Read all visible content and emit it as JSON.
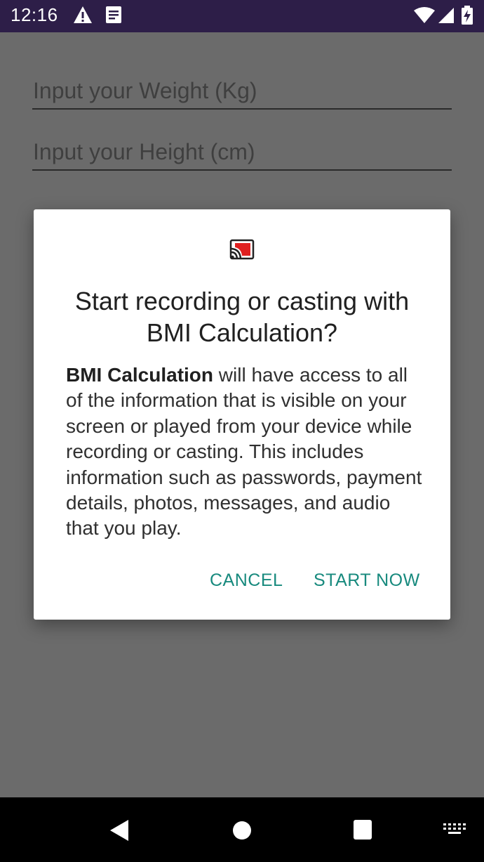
{
  "status_bar": {
    "time": "12:16",
    "left_icons": [
      "warning-icon",
      "notes-icon"
    ],
    "right_icons": [
      "wifi-icon",
      "signal-icon",
      "battery-charging-icon"
    ]
  },
  "form": {
    "weight_placeholder": "Input your Weight (Kg)",
    "height_placeholder": "Input your Height (cm)"
  },
  "dialog": {
    "icon": "cast-icon",
    "title": "Start recording or casting with BMI Calculation?",
    "message_app_name": "BMI Calculation",
    "message_rest": " will have access to all of the information that is visible on your screen or played from your device while recording or casting. This includes information such as passwords, payment details, photos, messages, and audio that you play.",
    "cancel_label": "CANCEL",
    "start_label": "START NOW",
    "accent_color": "#188a7e"
  },
  "nav_bar": {
    "buttons": [
      "back-icon",
      "home-icon",
      "recents-icon",
      "keyboard-icon"
    ]
  }
}
